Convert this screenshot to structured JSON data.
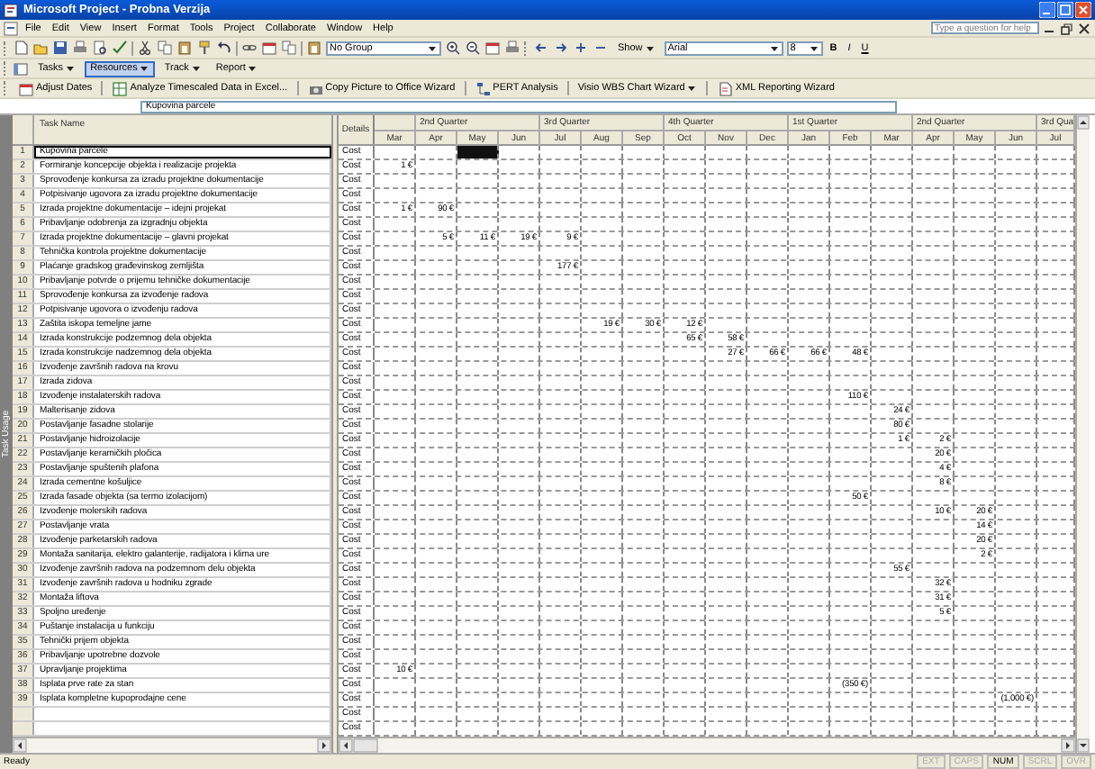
{
  "window": {
    "title": "Microsoft Project - Probna Verzija"
  },
  "menu": [
    "File",
    "Edit",
    "View",
    "Insert",
    "Format",
    "Tools",
    "Project",
    "Collaborate",
    "Window",
    "Help"
  ],
  "help_box": {
    "placeholder": "Type a question for help"
  },
  "standard_toolbar": {
    "group": "No Group",
    "show": "Show",
    "font": "Arial",
    "font_size": "8",
    "format_buttons": [
      "B",
      "I",
      "U"
    ]
  },
  "views_toolbar": [
    {
      "label": "Tasks",
      "selected": false
    },
    {
      "label": "Resources",
      "selected": true
    },
    {
      "label": "Track",
      "selected": false
    },
    {
      "label": "Report",
      "selected": false
    }
  ],
  "analysis_toolbar": [
    {
      "label": "Adjust Dates",
      "dropdown": false
    },
    {
      "label": "Analyze Timescaled Data in Excel...",
      "dropdown": false
    },
    {
      "label": "Copy Picture to Office Wizard",
      "dropdown": false
    },
    {
      "label": "PERT Analysis",
      "dropdown": false
    },
    {
      "label": "Visio WBS Chart Wizard",
      "dropdown": true
    },
    {
      "label": "XML Reporting Wizard",
      "dropdown": false
    }
  ],
  "entry_bar": "Kupovina parcele",
  "view_bar": "Task Usage",
  "table": {
    "name_header": "Task Name",
    "details_header": "Details"
  },
  "timescale": {
    "quarters": [
      {
        "months": [
          {
            "label": "Mar",
            "selected": false
          }
        ]
      },
      {
        "label": "2nd Quarter",
        "months": [
          {
            "label": "Apr",
            "selected": false
          },
          {
            "label": "May",
            "selected": true
          },
          {
            "label": "Jun",
            "selected": false
          }
        ]
      },
      {
        "label": "3rd Quarter",
        "months": [
          {
            "label": "Jul",
            "selected": false
          },
          {
            "label": "Aug",
            "selected": false
          },
          {
            "label": "Sep",
            "selected": false
          }
        ]
      },
      {
        "label": "4th Quarter",
        "months": [
          {
            "label": "Oct",
            "selected": false
          },
          {
            "label": "Nov",
            "selected": false
          },
          {
            "label": "Dec",
            "selected": false
          }
        ]
      },
      {
        "label": "1st Quarter",
        "months": [
          {
            "label": "Jan",
            "selected": false
          },
          {
            "label": "Feb",
            "selected": false
          },
          {
            "label": "Mar",
            "selected": false
          }
        ]
      },
      {
        "label": "2nd Quarter",
        "months": [
          {
            "label": "Apr",
            "selected": false
          },
          {
            "label": "May",
            "selected": false
          },
          {
            "label": "Jun",
            "selected": false
          }
        ]
      },
      {
        "label": "3rd Qua",
        "months": [
          {
            "label": "Jul",
            "selected": false
          }
        ]
      }
    ]
  },
  "rows": [
    {
      "number": "1",
      "name": "Kupovina parcele",
      "details": "Cost",
      "selected": true
    },
    {
      "number": "2",
      "name": "Formiranje koncepcije objekta i realizacije projekta",
      "details": "Cost",
      "selected": false,
      "costs": {
        "column_1": "1 €"
      }
    },
    {
      "number": "3",
      "name": "Sprovođenje konkursa za izradu projektne dokumentacije",
      "details": "Cost",
      "selected": false
    },
    {
      "number": "4",
      "name": "Potpisivanje ugovora za izradu projektne dokumentacije",
      "details": "Cost",
      "selected": false
    },
    {
      "number": "5",
      "name": "Izrada projektne dokumentacije – idejni projekat",
      "details": "Cost",
      "selected": false,
      "costs": {
        "column_1": "1 €",
        "column_2": "90 €"
      }
    },
    {
      "number": "6",
      "name": "Pribavljanje odobrenja za izgradnju objekta",
      "details": "Cost",
      "selected": false
    },
    {
      "number": "7",
      "name": "Izrada projektne dokumentacije – glavni projekat",
      "details": "Cost",
      "selected": false,
      "costs": {
        "column_2": "5 €",
        "column_3": "11 €",
        "column_4": "19 €",
        "column_5": "9 €"
      }
    },
    {
      "number": "8",
      "name": "Tehnička kontrola projektne dokumentacije",
      "details": "Cost",
      "selected": false
    },
    {
      "number": "9",
      "name": "Plaćanje gradskog građevinskog zemljišta",
      "details": "Cost",
      "selected": false,
      "costs": {
        "column_5": "177 €"
      }
    },
    {
      "number": "10",
      "name": "Pribavljanje potvrde o prijemu tehničke dokumentacije",
      "details": "Cost",
      "selected": false
    },
    {
      "number": "11",
      "name": "Sprovođenje konkursa za izvođenje radova",
      "details": "Cost",
      "selected": false
    },
    {
      "number": "12",
      "name": "Potpisivanje ugovora o izvođenju radova",
      "details": "Cost",
      "selected": false
    },
    {
      "number": "13",
      "name": "Zaštita iskopa temeljne jame",
      "details": "Cost",
      "selected": false,
      "costs": {
        "column_6": "19 €",
        "column_7": "30 €",
        "column_8": "12 €"
      }
    },
    {
      "number": "14",
      "name": "Izrada konstrukcije podzemnog dela objekta",
      "details": "Cost",
      "selected": false,
      "costs": {
        "column_8": "65 €",
        "column_9": "58 €"
      }
    },
    {
      "number": "15",
      "name": "Izrada konstrukcije nadzemnog dela objekta",
      "details": "Cost",
      "selected": false,
      "costs": {
        "column_9": "27 €",
        "column_10": "66 €",
        "column_11": "66 €",
        "column_12": "48 €"
      }
    },
    {
      "number": "16",
      "name": "Izvođenje završnih radova na krovu",
      "details": "Cost",
      "selected": false
    },
    {
      "number": "17",
      "name": "Izrada zidova",
      "details": "Cost",
      "selected": false
    },
    {
      "number": "18",
      "name": "Izvođenje instalaterskih radova",
      "details": "Cost",
      "selected": false,
      "costs": {
        "column_12": "110 €"
      }
    },
    {
      "number": "19",
      "name": "Malterisanje zidova",
      "details": "Cost",
      "selected": false,
      "costs": {
        "column_13": "24 €"
      }
    },
    {
      "number": "20",
      "name": "Postavljanje fasadne stolarije",
      "details": "Cost",
      "selected": false,
      "costs": {
        "column_13": "80 €"
      }
    },
    {
      "number": "21",
      "name": "Postavljanje hidroizolacije",
      "details": "Cost",
      "selected": false,
      "costs": {
        "column_13": "1 €",
        "column_14": "2 €"
      }
    },
    {
      "number": "22",
      "name": "Postavljanje keramičkih pločica",
      "details": "Cost",
      "selected": false,
      "costs": {
        "column_14": "20 €"
      }
    },
    {
      "number": "23",
      "name": "Postavljanje spuštenih plafona",
      "details": "Cost",
      "selected": false,
      "costs": {
        "column_14": "4 €"
      }
    },
    {
      "number": "24",
      "name": "Izrada cementne košuljice",
      "details": "Cost",
      "selected": false,
      "costs": {
        "column_14": "8 €"
      }
    },
    {
      "number": "25",
      "name": "Izrada fasade objekta (sa termo izolacijom)",
      "details": "Cost",
      "selected": false,
      "costs": {
        "column_12": "50 €"
      }
    },
    {
      "number": "26",
      "name": "Izvođenje molerskih radova",
      "details": "Cost",
      "selected": false,
      "costs": {
        "column_14": "10 €",
        "column_15": "20 €"
      }
    },
    {
      "number": "27",
      "name": "Postavljanje vrata",
      "details": "Cost",
      "selected": false,
      "costs": {
        "column_15": "14 €"
      }
    },
    {
      "number": "28",
      "name": "Izvođenje parketarskih radova",
      "details": "Cost",
      "selected": false,
      "costs": {
        "column_15": "20 €"
      }
    },
    {
      "number": "29",
      "name": "Montaža sanitarija, elektro galanterije, radijatora i klima ure",
      "details": "Cost",
      "selected": false,
      "costs": {
        "column_15": "2 €"
      }
    },
    {
      "number": "30",
      "name": "Izvođenje završnih radova na podzemnom delu objekta",
      "details": "Cost",
      "selected": false,
      "costs": {
        "column_13": "55 €"
      }
    },
    {
      "number": "31",
      "name": "Izvođenje završnih radova u hodniku zgrade",
      "details": "Cost",
      "selected": false,
      "costs": {
        "column_14": "32 €"
      }
    },
    {
      "number": "32",
      "name": "Montaža liftova",
      "details": "Cost",
      "selected": false,
      "costs": {
        "column_14": "31 €"
      }
    },
    {
      "number": "33",
      "name": "Spoljno uređenje",
      "details": "Cost",
      "selected": false,
      "costs": {
        "column_14": "5 €"
      }
    },
    {
      "number": "34",
      "name": "Puštanje instalacija u funkciju",
      "details": "Cost",
      "selected": false
    },
    {
      "number": "35",
      "name": "Tehnički prijem objekta",
      "details": "Cost",
      "selected": false
    },
    {
      "number": "36",
      "name": "Pribavljanje upotrebne dozvole",
      "details": "Cost",
      "selected": false
    },
    {
      "number": "37",
      "name": "Upravljanje projektima",
      "details": "Cost",
      "selected": false,
      "costs": {
        "column_1": "10 €"
      }
    },
    {
      "number": "38",
      "name": "Isplata prve rate za stan",
      "details": "Cost",
      "selected": false,
      "costs": {
        "column_12": "(350 €)"
      }
    },
    {
      "number": "39",
      "name": "Isplata kompletne kupoprodajne cene",
      "details": "Cost",
      "selected": false,
      "costs": {
        "column_16": "(1,000 €)"
      }
    },
    {
      "details": "Cost",
      "selected": false
    },
    {
      "details": "Cost",
      "selected": false
    }
  ],
  "status_bar": {
    "text": "Ready",
    "indicators": [
      {
        "label": "EXT",
        "on": false
      },
      {
        "label": "CAPS",
        "on": false
      },
      {
        "label": "NUM",
        "on": true
      },
      {
        "label": "SCRL",
        "on": false
      },
      {
        "label": "OVR",
        "on": false
      }
    ]
  }
}
